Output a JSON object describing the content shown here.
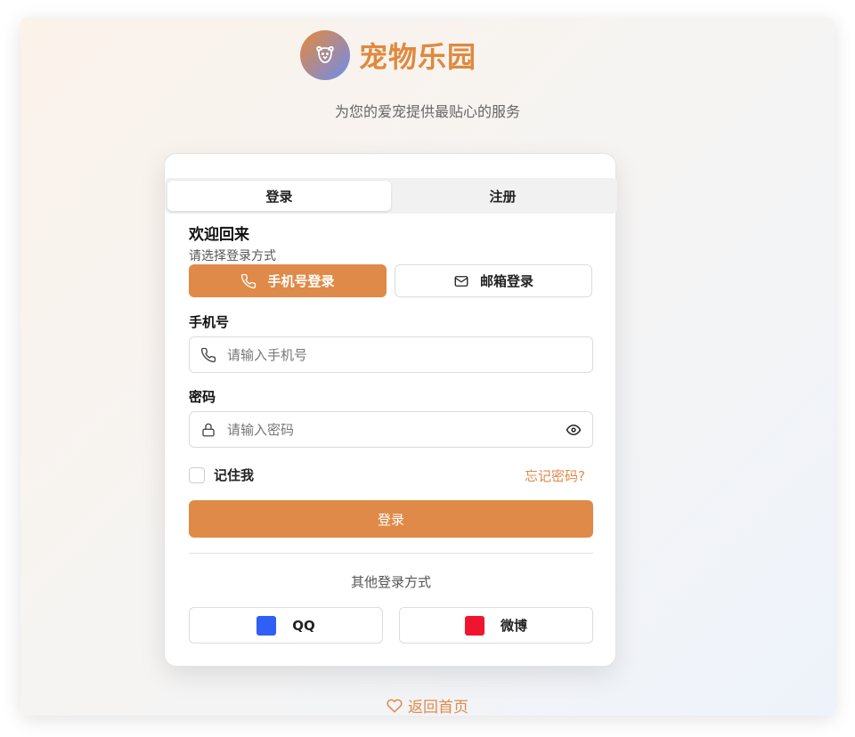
{
  "brand": {
    "name": "宠物乐园",
    "logo_icon": "paw-face-icon",
    "tagline": "为您的爱宠提供最贴心的服务"
  },
  "colors": {
    "accent": "#df8a48",
    "qq": "#2f5ff5",
    "weibo": "#f0152e"
  },
  "tabs": [
    {
      "label": "登录",
      "active": true
    },
    {
      "label": "注册",
      "active": false
    }
  ],
  "form": {
    "welcome": "欢迎回来",
    "subtitle": "请选择登录方式",
    "methods": {
      "phone": "手机号登录",
      "email": "邮箱登录"
    },
    "phone": {
      "label": "手机号",
      "placeholder": "请输入手机号",
      "value": ""
    },
    "password": {
      "label": "密码",
      "placeholder": "请输入密码",
      "value": ""
    },
    "remember": "记住我",
    "forgot": "忘记密码?",
    "submit": "登录"
  },
  "other": {
    "label": "其他登录方式",
    "qq": "QQ",
    "weibo": "微博"
  },
  "footer": {
    "back": "返回首页"
  }
}
